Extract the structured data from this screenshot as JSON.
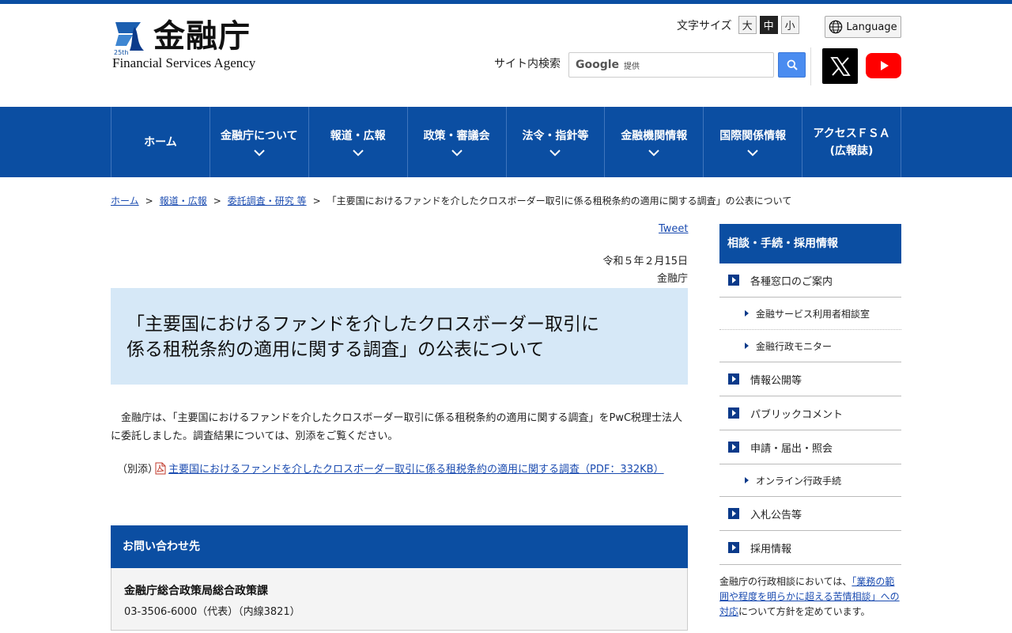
{
  "header": {
    "logo_jp": "金融庁",
    "logo_en": "Financial Services Agency",
    "font_size_label": "文字サイズ",
    "font_sizes": [
      "大",
      "中",
      "小"
    ],
    "language_label": "Language",
    "search_label": "サイト内検索",
    "search_brand": "Google",
    "search_brand_sub": "提供"
  },
  "nav": [
    {
      "label": "ホーム"
    },
    {
      "label": "金融庁について"
    },
    {
      "label": "報道・広報"
    },
    {
      "label": "政策・審議会"
    },
    {
      "label": "法令・指針等"
    },
    {
      "label": "金融機関情報"
    },
    {
      "label": "国際関係情報"
    },
    {
      "label": "アクセスＦＳＡ",
      "label2": "(広報誌)"
    }
  ],
  "breadcrumb": {
    "items": [
      "ホーム",
      "報道・広報",
      "委託調査・研究 等"
    ],
    "current": "「主要国におけるファンドを介したクロスボーダー取引に係る租税条約の適用に関する調査」の公表について",
    "separator": ">"
  },
  "main": {
    "tweet": "Tweet",
    "date": "令和５年２月15日",
    "issuer": "金融庁",
    "title_line1": "「主要国におけるファンドを介したクロスボーダー取引に",
    "title_line2": "係る租税条約の適用に関する調査」の公表について",
    "body": "　金融庁は、「主要国におけるファンドを介したクロスボーダー取引に係る租税条約の適用に関する調査」をPwC税理士法人に委託しました。調査結果については、別添をご覧ください。",
    "attachment_label": "（別添）",
    "attachment_link": "主要国におけるファンドを介したクロスボーダー取引に係る租税条約の適用に関する調査（PDF：332KB）"
  },
  "contact": {
    "heading": "お問い合わせ先",
    "org": "金融庁総合政策局総合政策課",
    "tel": "03-3506-6000（代表）（内線3821）"
  },
  "sidebar": {
    "heading": "相談・手続・採用情報",
    "items": [
      {
        "label": "各種窓口のご案内",
        "type": "main"
      },
      {
        "label": "金融サービス利用者相談室",
        "type": "sub"
      },
      {
        "label": "金融行政モニター",
        "type": "sub"
      },
      {
        "label": "情報公開等",
        "type": "main"
      },
      {
        "label": "パブリックコメント",
        "type": "main"
      },
      {
        "label": "申請・届出・照会",
        "type": "main"
      },
      {
        "label": "オンライン行政手続",
        "type": "sub"
      },
      {
        "label": "入札公告等",
        "type": "main"
      },
      {
        "label": "採用情報",
        "type": "main"
      }
    ],
    "note_prefix": "金融庁の行政相談においては、",
    "note_link": "「業務の範囲や程度を明らかに超える苦情相談」への対応",
    "note_suffix": "について方針を定めています。"
  },
  "colors": {
    "primary": "#0b4ea2",
    "title_bg": "#d6e8f7",
    "link": "#1a4bb0"
  }
}
